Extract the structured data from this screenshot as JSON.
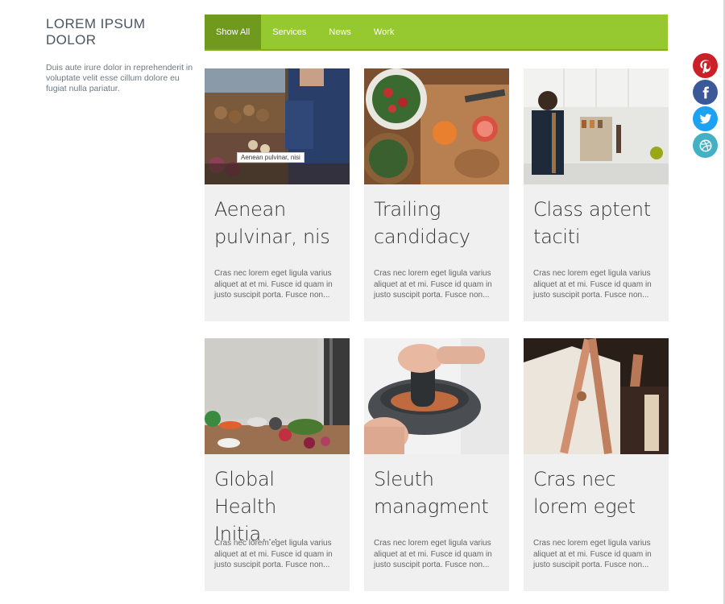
{
  "sidebar": {
    "title": "LOREM IPSUM DOLOR",
    "description": "Duis aute irure dolor in reprehenderit in voluptate velit esse cillum dolore eu fugiat nulla pariatur."
  },
  "filters": [
    {
      "label": "Show All",
      "active": true
    },
    {
      "label": "Services"
    },
    {
      "label": "News"
    },
    {
      "label": "Work"
    }
  ],
  "cards": [
    {
      "title": "Aenean pulvinar, nis",
      "text": "Cras nec lorem eget ligula varius aliquet at et mi. Fusce id quam in justo suscipit porta. Fusce non...",
      "image": "market-vegetables"
    },
    {
      "title": "Trailing candidacy",
      "text": "Cras nec lorem eget ligula varius aliquet at et mi. Fusce id quam in justo suscipit porta. Fusce non...",
      "image": "salad-and-oranges"
    },
    {
      "title": "Class aptent taciti",
      "text": "Cras nec lorem eget ligula varius aliquet at et mi. Fusce id quam in justo suscipit porta. Fusce non...",
      "image": "kitchen-cook"
    },
    {
      "title": "Global Health Initia...",
      "text": "Cras nec lorem eget ligula varius aliquet at et mi. Fusce id quam in justo suscipit porta. Fusce non...",
      "image": "vegetable-table"
    },
    {
      "title": "Sleuth managment",
      "text": "Cras nec lorem eget ligula varius aliquet at et mi. Fusce id quam in justo suscipit porta. Fusce non...",
      "image": "mortar-and-pestle"
    },
    {
      "title": "Cras nec lorem eget",
      "text": "Cras nec lorem eget ligula varius aliquet at et mi. Fusce id quam in justo suscipit porta. Fusce non...",
      "image": "leather-apron"
    }
  ],
  "tooltip": "Aenean pulvinar, nisi",
  "social": [
    {
      "icon": "pinterest-icon",
      "color": "#cb2027"
    },
    {
      "icon": "facebook-icon",
      "color": "#3b5998"
    },
    {
      "icon": "twitter-icon",
      "color": "#1da1f2"
    },
    {
      "icon": "dribbble-icon",
      "color": "#44b0c4"
    }
  ],
  "colors": {
    "accent": "#96c92f",
    "accent_active": "#6f9a1d",
    "card_bg": "#f0f0f0"
  }
}
